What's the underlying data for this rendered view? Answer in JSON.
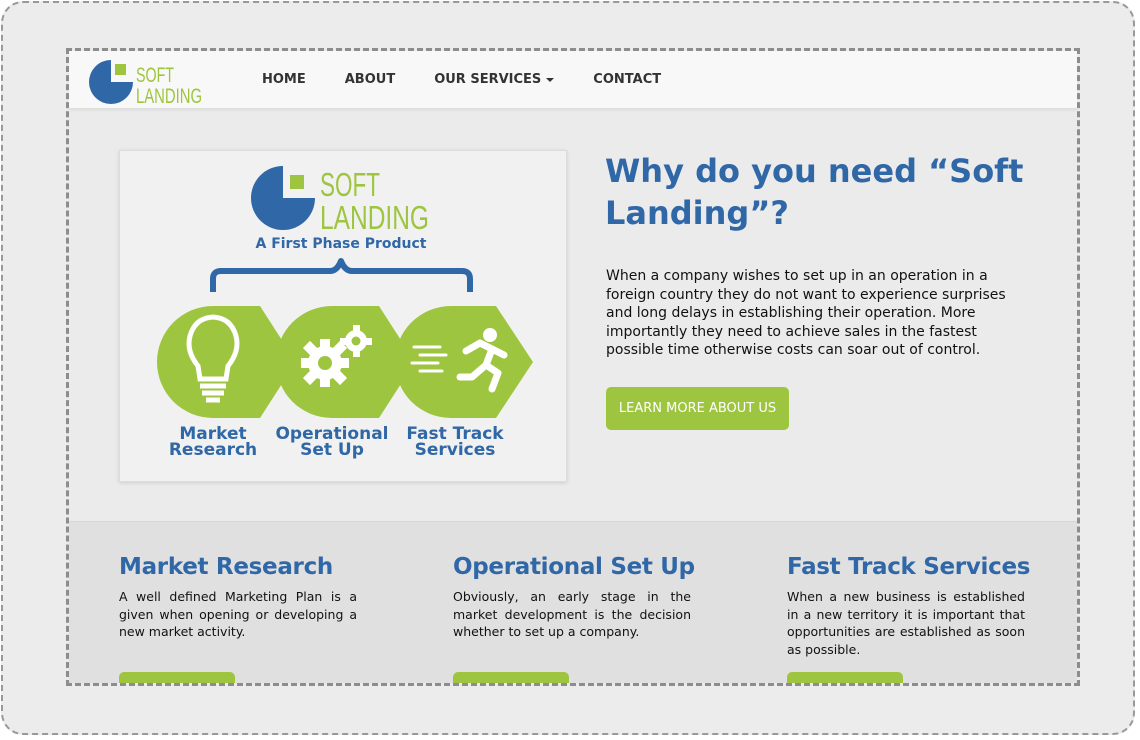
{
  "brand": {
    "logo_line1": "SOFT",
    "logo_line2": "LANDING"
  },
  "nav": {
    "items": [
      {
        "label": "HOME"
      },
      {
        "label": "ABOUT"
      },
      {
        "label": "OUR SERVICES"
      },
      {
        "label": "CONTACT"
      }
    ]
  },
  "hero": {
    "image": {
      "logo_line1": "SOFT",
      "logo_line2": "LANDING",
      "tagline": "A First Phase Product",
      "steps": [
        {
          "line1": "Market",
          "line2": "Research"
        },
        {
          "line1": "Operational",
          "line2": "Set Up"
        },
        {
          "line1": "Fast Track",
          "line2": "Services"
        }
      ]
    },
    "title": "Why do you need “Soft Landing”?",
    "text": "When a company wishes to set up in an operation in a foreign country they do not want to experience surprises and long delays in establishing their operation. More importantly they need to achieve sales in the fastest possible time otherwise costs can soar out of control.",
    "button_label": "LEARN MORE ABOUT US"
  },
  "features": [
    {
      "title": "Market Research",
      "text": "A well defined Marketing Plan is a given when opening or developing a new market activity."
    },
    {
      "title": "Operational Set Up",
      "text": "Obviously, an early stage in the market development is the decision whether to set up a company."
    },
    {
      "title": "Fast Track Services",
      "text": "When a new business is established in a new territory it is important that opportunities are established as soon as possible."
    }
  ],
  "colors": {
    "brand_blue": "#2f67a7",
    "brand_green": "#9ec53f",
    "navbar_bg": "#f8f8f8",
    "page_bg": "#ebebeb"
  },
  "icons": [
    "lightbulb-icon",
    "gears-icon",
    "running-man-icon",
    "caret-down-icon"
  ]
}
